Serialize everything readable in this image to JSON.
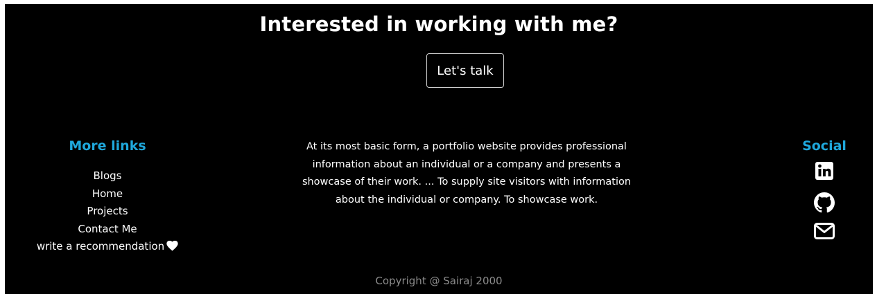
{
  "cta": {
    "title": "Interested in working with me?",
    "button_label": "Let's talk"
  },
  "more_links": {
    "heading": "More links",
    "items": [
      {
        "label": "Blogs"
      },
      {
        "label": "Home"
      },
      {
        "label": "Projects"
      },
      {
        "label": "Contact Me"
      },
      {
        "label": "write a recommendation",
        "icon": "heart-icon"
      }
    ]
  },
  "about": {
    "text": "At its most basic form, a portfolio website provides professional information about an individual or a company and presents a showcase of their work. ... To supply site visitors with information about the individual or company. To showcase work."
  },
  "social": {
    "heading": "Social",
    "icons": [
      "linkedin-icon",
      "github-icon",
      "mail-icon"
    ]
  },
  "footer": {
    "copyright": "Copyright @ Sairaj 2000"
  },
  "colors": {
    "background": "#000000",
    "accent": "#1fa8dc",
    "text": "#ffffff",
    "muted": "#8c8c8c"
  }
}
